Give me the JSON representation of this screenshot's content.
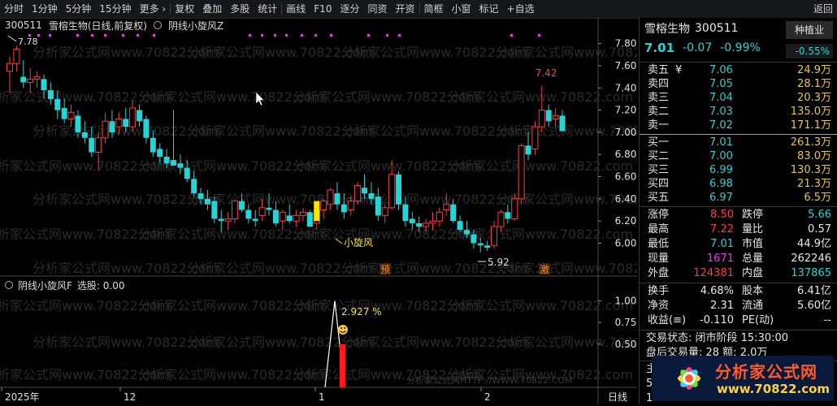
{
  "toolbar": {
    "items": [
      "分时",
      "1分钟",
      "5分钟",
      "15分钟",
      "更多 ›",
      "复权",
      "叠加",
      "多股",
      "统计",
      "画线",
      "F10",
      "逐分",
      "同资",
      "开资",
      "简框",
      "小窗",
      "标记",
      "+自选"
    ],
    "back": "返回"
  },
  "chart": {
    "code": "300511",
    "title": "雪榕生物(日线,前复权)",
    "indicator": "阴线小旋风Z",
    "sub_indicator": "阴线小旋风F",
    "sub_select": "选股: 0.00",
    "high_label": "7.78",
    "peak_label": "7.42",
    "low_label": "5.92",
    "signal_label": "小旋风",
    "tag_yu": "预",
    "tag_ji": "激",
    "sub_value_label": "2.927 %",
    "y_ticks": [
      "7.80",
      "7.60",
      "7.40",
      "7.20",
      "7.00",
      "6.80",
      "6.60",
      "6.40",
      "6.20",
      "6.00"
    ],
    "sub_y_ticks": [
      "1.00",
      "0.75",
      "0.50"
    ],
    "x_labels": [
      "2025年",
      "12",
      "1",
      "2"
    ],
    "x_right": "日线",
    "watermark_text": "分析家公式网www.70822.com",
    "bottom_watermark": "分析家公式网HTTP://WWW.70822.COM"
  },
  "chart_data": {
    "type": "candlestick",
    "ylim": [
      5.85,
      7.9
    ],
    "candles": [
      [
        7.55,
        7.68,
        7.35,
        7.62
      ],
      [
        7.62,
        7.78,
        7.55,
        7.75
      ],
      [
        7.5,
        7.65,
        7.4,
        7.45
      ],
      [
        7.45,
        7.58,
        7.35,
        7.48
      ],
      [
        7.48,
        7.55,
        7.4,
        7.5
      ],
      [
        7.48,
        7.52,
        7.3,
        7.38
      ],
      [
        7.38,
        7.45,
        7.25,
        7.3
      ],
      [
        7.3,
        7.38,
        7.12,
        7.2
      ],
      [
        7.22,
        7.3,
        7.08,
        7.12
      ],
      [
        7.12,
        7.25,
        7.05,
        7.18
      ],
      [
        7.15,
        7.2,
        6.95,
        7.0
      ],
      [
        7.0,
        7.1,
        6.9,
        6.95
      ],
      [
        6.95,
        7.05,
        6.78,
        6.82
      ],
      [
        6.82,
        7.0,
        6.65,
        6.95
      ],
      [
        6.95,
        7.18,
        6.9,
        7.1
      ],
      [
        7.1,
        7.2,
        6.95,
        7.0
      ],
      [
        7.05,
        7.18,
        6.98,
        7.12
      ],
      [
        7.12,
        7.22,
        7.0,
        7.05
      ],
      [
        7.05,
        7.28,
        7.0,
        7.22
      ],
      [
        7.2,
        7.25,
        7.05,
        7.1
      ],
      [
        7.12,
        7.15,
        6.9,
        6.95
      ],
      [
        6.95,
        7.02,
        6.78,
        6.82
      ],
      [
        6.85,
        6.9,
        6.72,
        6.78
      ],
      [
        6.78,
        6.85,
        6.68,
        6.72
      ],
      [
        6.75,
        7.2,
        6.7,
        6.7
      ],
      [
        6.72,
        6.8,
        6.62,
        6.68
      ],
      [
        6.68,
        6.75,
        6.55,
        6.58
      ],
      [
        6.58,
        6.65,
        6.42,
        6.45
      ],
      [
        6.45,
        6.5,
        6.35,
        6.4
      ],
      [
        6.4,
        6.48,
        6.3,
        6.35
      ],
      [
        6.38,
        6.42,
        6.18,
        6.22
      ],
      [
        6.22,
        6.3,
        6.1,
        6.2
      ],
      [
        6.2,
        6.28,
        6.12,
        6.22
      ],
      [
        6.22,
        6.4,
        6.18,
        6.38
      ],
      [
        6.38,
        6.45,
        6.28,
        6.3
      ],
      [
        6.3,
        6.35,
        6.18,
        6.22
      ],
      [
        6.22,
        6.3,
        6.15,
        6.2
      ],
      [
        6.25,
        6.4,
        6.2,
        6.32
      ],
      [
        6.32,
        6.45,
        6.25,
        6.3
      ],
      [
        6.3,
        6.38,
        6.15,
        6.18
      ],
      [
        6.2,
        6.3,
        6.12,
        6.28
      ],
      [
        6.25,
        6.35,
        6.18,
        6.2
      ],
      [
        6.2,
        6.3,
        6.15,
        6.25
      ],
      [
        6.25,
        6.32,
        6.2,
        6.28
      ],
      [
        6.28,
        6.3,
        6.15,
        6.15
      ],
      [
        6.18,
        6.35,
        6.12,
        6.3
      ],
      [
        6.3,
        6.4,
        6.22,
        6.38
      ],
      [
        6.35,
        6.5,
        6.3,
        6.48
      ],
      [
        6.45,
        6.55,
        6.3,
        6.35
      ],
      [
        6.35,
        6.45,
        6.22,
        6.28
      ],
      [
        6.3,
        6.42,
        6.25,
        6.38
      ],
      [
        6.38,
        6.55,
        6.35,
        6.52
      ],
      [
        6.5,
        6.62,
        6.4,
        6.45
      ],
      [
        6.45,
        6.55,
        6.35,
        6.4
      ],
      [
        6.42,
        6.5,
        6.2,
        6.25
      ],
      [
        6.25,
        6.35,
        6.18,
        6.32
      ],
      [
        6.32,
        6.75,
        6.3,
        6.62
      ],
      [
        6.62,
        6.65,
        6.3,
        6.35
      ],
      [
        6.35,
        6.42,
        6.15,
        6.2
      ],
      [
        6.22,
        6.28,
        6.12,
        6.18
      ],
      [
        6.18,
        6.24,
        6.1,
        6.15
      ],
      [
        6.15,
        6.22,
        6.1,
        6.18
      ],
      [
        6.18,
        6.28,
        6.12,
        6.2
      ],
      [
        6.2,
        6.32,
        6.15,
        6.28
      ],
      [
        6.3,
        6.45,
        6.25,
        6.35
      ],
      [
        6.35,
        6.4,
        6.18,
        6.2
      ],
      [
        6.2,
        6.25,
        6.1,
        6.12
      ],
      [
        6.12,
        6.2,
        6.05,
        6.08
      ],
      [
        6.08,
        6.12,
        5.95,
        6.0
      ],
      [
        6.0,
        6.05,
        5.92,
        5.98
      ],
      [
        5.98,
        6.02,
        5.93,
        5.96
      ],
      [
        5.98,
        6.2,
        5.95,
        6.15
      ],
      [
        6.15,
        6.3,
        6.1,
        6.28
      ],
      [
        6.28,
        6.35,
        6.18,
        6.22
      ],
      [
        6.22,
        6.45,
        6.2,
        6.4
      ],
      [
        6.4,
        6.9,
        6.35,
        6.88
      ],
      [
        6.88,
        7.0,
        6.75,
        6.8
      ],
      [
        6.85,
        7.1,
        6.8,
        7.05
      ],
      [
        7.05,
        7.42,
        7.0,
        7.2
      ],
      [
        7.2,
        7.25,
        7.05,
        7.1
      ],
      [
        7.12,
        7.22,
        7.05,
        7.15
      ],
      [
        7.15,
        7.2,
        7.01,
        7.01
      ]
    ],
    "sub_series": {
      "name": "阴线小旋风F",
      "peak": 1.0,
      "bar": 0.5
    }
  },
  "quote": {
    "name": "雪榕生物",
    "code": "300511",
    "sector": "种植业",
    "price": "7.01",
    "change": "-0.07",
    "change_pct": "-0.99%",
    "sector_pct": "-0.55%",
    "asks": [
      {
        "label": "卖五",
        "mark": "¥",
        "price": "7.06",
        "vol": "24.9万"
      },
      {
        "label": "卖四",
        "mark": "",
        "price": "7.05",
        "vol": "28.1万"
      },
      {
        "label": "卖三",
        "mark": "",
        "price": "7.04",
        "vol": "20.3万"
      },
      {
        "label": "卖二",
        "mark": "",
        "price": "7.03",
        "vol": "135.0万"
      },
      {
        "label": "卖一",
        "mark": "",
        "price": "7.02",
        "vol": "171.1万"
      }
    ],
    "bids": [
      {
        "label": "买一",
        "price": "7.01",
        "vol": "261.3万"
      },
      {
        "label": "买二",
        "price": "7.00",
        "vol": "83.0万"
      },
      {
        "label": "买三",
        "price": "6.99",
        "vol": "130.3万"
      },
      {
        "label": "买四",
        "price": "6.98",
        "vol": "21.3万"
      },
      {
        "label": "买五",
        "price": "6.97",
        "vol": "6.5万"
      }
    ],
    "stats": [
      {
        "k1": "涨停",
        "v1": "8.50",
        "c1": "red",
        "k2": "跌停",
        "v2": "5.66",
        "c2": "green"
      },
      {
        "k1": "最高",
        "v1": "7.22",
        "c1": "red",
        "k2": "量比",
        "v2": "0.57",
        "c2": "white"
      },
      {
        "k1": "最低",
        "v1": "7.01",
        "c1": "green",
        "k2": "市值",
        "v2": "44.9亿",
        "c2": "white"
      },
      {
        "k1": "现量",
        "v1": "1671",
        "c1": "magenta",
        "k2": "总量",
        "v2": "262246",
        "c2": "white"
      },
      {
        "k1": "外盘",
        "v1": "124381",
        "c1": "red",
        "k2": "内盘",
        "v2": "137865",
        "c2": "green"
      }
    ],
    "stats2": [
      {
        "k1": "换手",
        "v1": "4.68%",
        "k2": "股本",
        "v2": "6.41亿"
      },
      {
        "k1": "净资",
        "v1": "2.31",
        "k2": "流通",
        "v2": "5.60亿"
      },
      {
        "k1": "收益(≡)",
        "v1": "-0.110",
        "k2": "PE(动)",
        "v2": "--"
      }
    ],
    "trade_state": "交易状态: 闭市阶段 15:30:00",
    "after_hours": "盘后交易量: 28  额: 2.0万",
    "partial1": "主力",
    "partial2": "5日",
    "partial3": "15:"
  },
  "logo": {
    "title": "分析家公式网",
    "url": "www.70822.com"
  }
}
